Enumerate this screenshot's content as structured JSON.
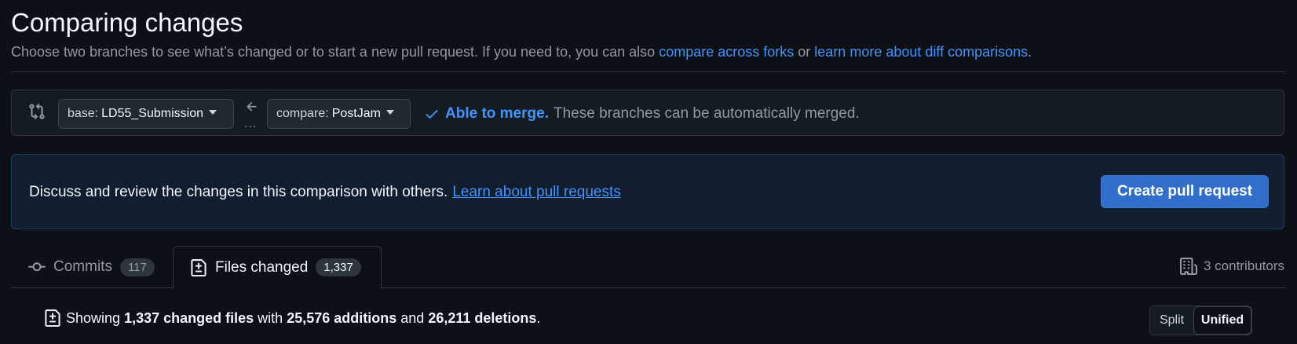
{
  "header": {
    "title": "Comparing changes",
    "subtitle_text": "Choose two branches to see what’s changed or to start a new pull request. If you need to, you can also",
    "link_forks": "compare across forks",
    "or_text": "or",
    "link_learn_diff": "learn more about diff comparisons",
    "period": "."
  },
  "compare": {
    "base_prefix": "base:",
    "base_ref": "LD55_Submission",
    "head_prefix": "compare:",
    "head_ref": "PostJam",
    "dots": "...",
    "merge_able": "Able to merge.",
    "merge_desc": "These branches can be automatically merged."
  },
  "info": {
    "text": "Discuss and review the changes in this comparison with others.",
    "link": "Learn about pull requests",
    "create_button": "Create pull request"
  },
  "tabs": [
    {
      "label": "Commits",
      "count": "117"
    },
    {
      "label": "Files changed",
      "count": "1,337"
    }
  ],
  "contributors": "3 contributors",
  "summary": {
    "showing": "Showing",
    "files": "1,337 changed files",
    "with": "with",
    "additions": "25,576 additions",
    "and": "and",
    "deletions": "26,211 deletions",
    "period": "."
  },
  "view_toggle": {
    "split": "Split",
    "unified": "Unified",
    "selected": "Unified"
  },
  "colors": {
    "accent": "#4493f8",
    "button_blue": "#316dca",
    "background": "#0d1117"
  }
}
